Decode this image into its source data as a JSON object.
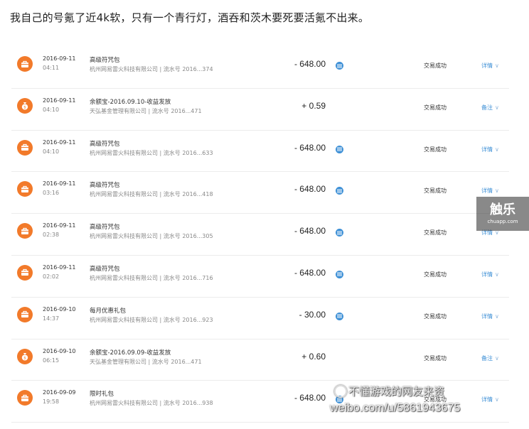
{
  "heading": "我自己的号氪了近4k软，只有一个青行灯，酒吞和茨木要死要活氪不出来。",
  "colors": {
    "icon_orange": "#f27a2a",
    "link_blue": "#3c8fd6"
  },
  "transactions": [
    {
      "date": "2016-09-11",
      "time": "04:11",
      "title": "高级符咒包",
      "sub": "杭州网易雷火科技有限公司 | 流水号 2016...374",
      "amount": "- 648.00",
      "memo": true,
      "status": "交易成功",
      "action": "详情",
      "icon": "bag-icon"
    },
    {
      "date": "2016-09-11",
      "time": "04:10",
      "title": "余额宝-2016.09.10-收益发放",
      "sub": "天弘基金管理有限公司 | 流水号 2016...471",
      "amount": "+ 0.59",
      "memo": false,
      "status": "交易成功",
      "action": "备注",
      "icon": "money-bag-icon"
    },
    {
      "date": "2016-09-11",
      "time": "04:10",
      "title": "高级符咒包",
      "sub": "杭州网易雷火科技有限公司 | 流水号 2016...633",
      "amount": "- 648.00",
      "memo": true,
      "status": "交易成功",
      "action": "详情",
      "icon": "bag-icon"
    },
    {
      "date": "2016-09-11",
      "time": "03:16",
      "title": "高级符咒包",
      "sub": "杭州网易雷火科技有限公司 | 流水号 2016...418",
      "amount": "- 648.00",
      "memo": true,
      "status": "交易成功",
      "action": "详情",
      "icon": "bag-icon"
    },
    {
      "date": "2016-09-11",
      "time": "02:38",
      "title": "高级符咒包",
      "sub": "杭州网易雷火科技有限公司 | 流水号 2016...305",
      "amount": "- 648.00",
      "memo": true,
      "status": "交易成功",
      "action": "详情",
      "icon": "bag-icon"
    },
    {
      "date": "2016-09-11",
      "time": "02:02",
      "title": "高级符咒包",
      "sub": "杭州网易雷火科技有限公司 | 流水号 2016...716",
      "amount": "- 648.00",
      "memo": true,
      "status": "交易成功",
      "action": "详情",
      "icon": "bag-icon"
    },
    {
      "date": "2016-09-10",
      "time": "14:37",
      "title": "每月优惠礼包",
      "sub": "杭州网易雷火科技有限公司 | 流水号 2016...923",
      "amount": "- 30.00",
      "memo": true,
      "status": "交易成功",
      "action": "详情",
      "icon": "bag-icon"
    },
    {
      "date": "2016-09-10",
      "time": "06:15",
      "title": "余额宝-2016.09.09-收益发放",
      "sub": "天弘基金管理有限公司 | 流水号 2016...471",
      "amount": "+ 0.60",
      "memo": false,
      "status": "交易成功",
      "action": "备注",
      "icon": "money-bag-icon"
    },
    {
      "date": "2016-09-09",
      "time": "19:58",
      "title": "限时礼包",
      "sub": "杭州网易雷火科技有限公司 | 流水号 2016...938",
      "amount": "- 648.00",
      "memo": true,
      "status": "交易成功",
      "action": "详情",
      "icon": "bag-icon"
    }
  ],
  "watermarks": {
    "site_big": "触乐",
    "site_small": "chuapp.com",
    "weibo_name": "不懂游戏的网友来资",
    "weibo_url": "weibo.com/u/5861943675"
  }
}
